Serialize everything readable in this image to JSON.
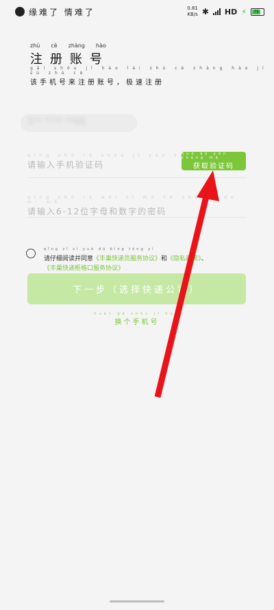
{
  "status_bar": {
    "title": "缘难了 情难了",
    "speed_value": "0.81",
    "speed_unit": "KB/s",
    "network": "HD",
    "battery": "75"
  },
  "header": {
    "title_pinyin": [
      "zhù",
      "cè",
      "zhàng",
      "hào"
    ],
    "title": "注册账号",
    "subtitle_pinyin": "gāi shǒu jī hào lái zhù cè zhàng hào jí sù zhù cè",
    "subtitle": "该手机号来注册账号，极速注册"
  },
  "form": {
    "phone_value": "1** **** **00",
    "code_pinyin": "qǐng shū rù shǒu jī yàn zhèng mǎ",
    "code_placeholder": "请输入手机验证码",
    "get_code_pinyin": "huò qǔ yàn zhèng mǎ",
    "get_code_label": "获取验证码",
    "password_pinyin": "qǐng shū rù wèi zì mǔ hé shù zì de mì mǎ",
    "password_placeholder": "请输入6-12位字母和数字的密码"
  },
  "agreement": {
    "pinyin": "qǐng zǐ xì yuè dú bìng tóng yì",
    "prefix": "请仔细阅读并同意",
    "link1": "《丰巢快递员服务协议》",
    "and": "和",
    "link2": "《隐私政策》",
    "sep": "、",
    "link3": "《丰巢快递柜格口服务协议》"
  },
  "actions": {
    "next_label": "下一步（选择快递公司）",
    "switch_pinyin": "huàn gè shǒu jī hào",
    "switch_label": "换个手机号"
  },
  "colors": {
    "accent": "#7cc63a",
    "disabled_button": "#c5e9a5",
    "arrow": "#e8141a"
  }
}
